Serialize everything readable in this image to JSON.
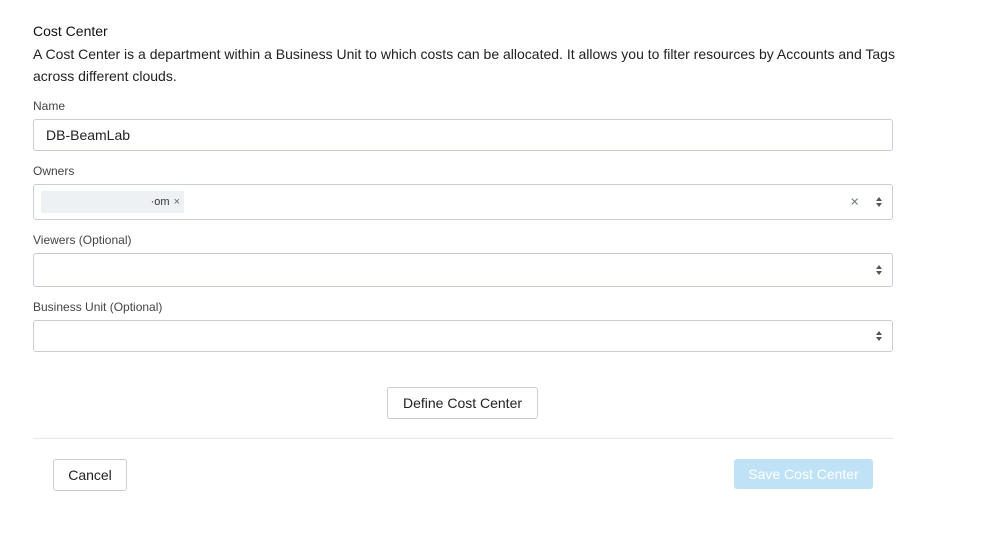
{
  "header": {
    "title": "Cost Center",
    "description": "A Cost Center is a department within a Business Unit to which costs can be allocated. It allows you to filter resources by Accounts and Tags across different clouds."
  },
  "fields": {
    "name": {
      "label": "Name",
      "value": "DB-BeamLab"
    },
    "owners": {
      "label": "Owners",
      "chips": [
        {
          "text": "·om",
          "remove_glyph": "×"
        }
      ],
      "clear_glyph": "×",
      "clear_icon": "close-icon",
      "indicator_icon": "sort-arrows-icon"
    },
    "viewers": {
      "label": "Viewers (Optional)",
      "value": "",
      "indicator_icon": "sort-arrows-icon"
    },
    "business_unit": {
      "label": "Business Unit (Optional)",
      "value": "",
      "indicator_icon": "sort-arrows-icon"
    }
  },
  "actions": {
    "define_label": "Define Cost Center",
    "cancel_label": "Cancel",
    "save_label": "Save Cost Center",
    "save_disabled": true
  },
  "colors": {
    "save_disabled_bg": "#bfe2f6",
    "border": "#c9ced4",
    "chip_bg": "#eef1f4"
  }
}
